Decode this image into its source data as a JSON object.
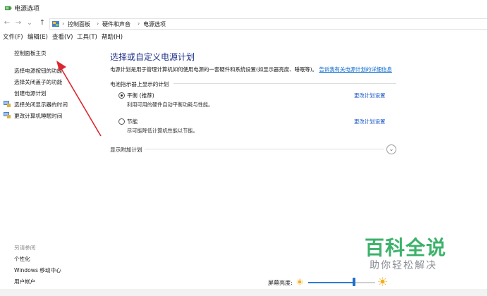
{
  "window": {
    "title": "电源选项"
  },
  "address": {
    "crumbs": [
      "控制面板",
      "硬件和声音",
      "电源选项"
    ]
  },
  "menu": [
    "文件(F)",
    "编辑(E)",
    "查看(V)",
    "工具(T)",
    "帮助(H)"
  ],
  "sidebar": {
    "home": "控制面板主页",
    "links": [
      "选择电源按钮的功能",
      "选择关闭盖子的功能",
      "创建电源计划",
      "选择关闭显示器的时间",
      "更改计算机睡眠时间"
    ],
    "see_also_title": "另请参阅",
    "see_also": [
      "个性化",
      "Windows 移动中心",
      "用户帐户"
    ]
  },
  "main": {
    "title": "选择或自定义电源计划",
    "description": "电源计划是用于管理计算机如何使用电源的一套硬件和系统设置(如显示器亮度、睡眠等)。",
    "description_link": "告诉我有关电源计划的详细信息",
    "group_label": "电池指示器上显示的计划",
    "plans": [
      {
        "name": "平衡 (推荐)",
        "description": "利用可用的硬件自动平衡功耗与性能。",
        "link": "更改计划设置",
        "selected": true
      },
      {
        "name": "节能",
        "description": "尽可能降低计算机性能以节能。",
        "link": "更改计划设置",
        "selected": false
      }
    ],
    "extra_plans": "显示附加计划"
  },
  "footer": {
    "brightness_label": "屏幕亮度:",
    "brightness_level": 0.68
  },
  "watermark": {
    "main": "百科全说",
    "sub": "助你轻松解决"
  },
  "colors": {
    "title_blue": "#1e3287",
    "link_blue": "#0066cc",
    "watermark_green": "#3cb26b",
    "arrow_red": "#d9282f"
  },
  "icons": [
    "power-options-icon",
    "control-panel-icon",
    "shield-icon",
    "sun-icon"
  ]
}
